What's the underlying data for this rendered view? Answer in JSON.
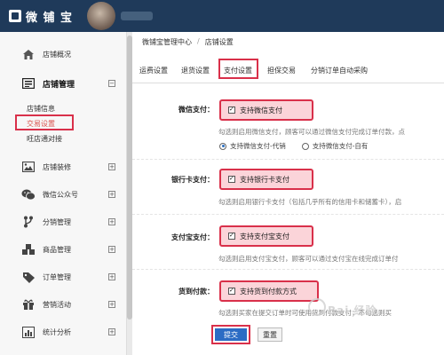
{
  "topbar": {
    "logo_text": "微 铺 宝"
  },
  "sidebar": {
    "items": [
      {
        "id": "shop-overview",
        "label": "店铺概况",
        "icon": "home-icon",
        "expandable": false
      },
      {
        "id": "shop-manage",
        "label": "店铺管理",
        "icon": "list-icon",
        "expandable": true,
        "toggle": "⊟"
      },
      {
        "id": "shop-decor",
        "label": "店铺装修",
        "icon": "image-icon",
        "expandable": true,
        "toggle": "⊞"
      },
      {
        "id": "wechat-account",
        "label": "微信公众号",
        "icon": "wechat-icon",
        "expandable": true,
        "toggle": "⊞"
      },
      {
        "id": "distribution",
        "label": "分销管理",
        "icon": "fork-icon",
        "expandable": true,
        "toggle": "⊞"
      },
      {
        "id": "goods",
        "label": "商品管理",
        "icon": "boxes-icon",
        "expandable": true,
        "toggle": "⊞"
      },
      {
        "id": "orders",
        "label": "订单管理",
        "icon": "tag-icon",
        "expandable": true,
        "toggle": "⊞"
      },
      {
        "id": "marketing",
        "label": "营销活动",
        "icon": "gift-icon",
        "expandable": true,
        "toggle": "⊞"
      },
      {
        "id": "stats",
        "label": "统计分析",
        "icon": "bar-chart-icon",
        "expandable": true,
        "toggle": "⊞"
      }
    ],
    "sub_items": [
      {
        "label": "店铺信息",
        "active": false
      },
      {
        "label": "交易设置",
        "active": true
      },
      {
        "label": "旺店通对接",
        "active": false
      }
    ]
  },
  "main": {
    "breadcrumb": {
      "root": "微铺宝管理中心",
      "separator": "/",
      "current": "店铺设置"
    },
    "tabs": [
      {
        "label": "运费设置",
        "active": false
      },
      {
        "label": "退货设置",
        "active": false
      },
      {
        "label": "支付设置",
        "active": true
      },
      {
        "label": "担保交易",
        "active": false
      },
      {
        "label": "分销订单自动采购",
        "active": false
      }
    ],
    "rows": [
      {
        "label": "微信支付：",
        "checkbox_label": "支持微信支付",
        "checked": true,
        "hint": "勾选则启用微信支付，顾客可以通过微信支付完成订单付款，点",
        "radios": [
          {
            "label": "支持微信支付-代销",
            "selected": true
          },
          {
            "label": "支持微信支付-自有",
            "selected": false
          }
        ]
      },
      {
        "label": "银行卡支付：",
        "checkbox_label": "支持银行卡支付",
        "checked": true,
        "hint": "勾选则启用银行卡支付（包括几乎所有的信用卡和储蓄卡），启"
      },
      {
        "label": "支付宝支付：",
        "checkbox_label": "支持支付宝支付",
        "checked": true,
        "hint": "勾选则启用支付宝支付，顾客可以通过支付宝在线完成订单付"
      },
      {
        "label": "货到付款：",
        "checkbox_label": "支持货到付款方式",
        "checked": true,
        "hint": "勾选则买家在提交订单时可使用货到付款支付；不勾选则买"
      }
    ],
    "buttons": {
      "submit": "提交",
      "reset": "重置"
    },
    "watermark": "Bai 经验"
  },
  "colors": {
    "topbar": "#1f3a5a",
    "highlight_border": "#d9304a",
    "checkbox_fill": "#fbd4d9",
    "primary_button": "#2c6cc4"
  }
}
